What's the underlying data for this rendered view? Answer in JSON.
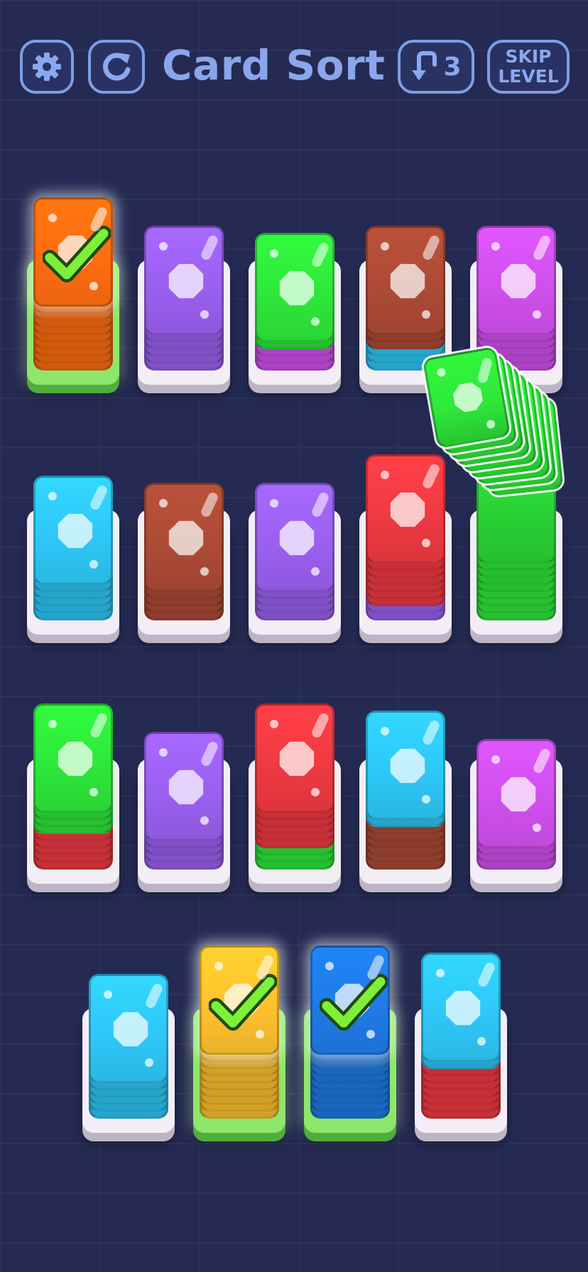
{
  "header": {
    "title": "Card Sort",
    "settings_icon": "gear-icon",
    "restart_icon": "restart-icon",
    "undo_icon": "undo-arrow-icon",
    "undo_count": "3",
    "skip_label_line1": "SKIP",
    "skip_label_line2": "LEVEL"
  },
  "colors": {
    "orange": "#ff6d10",
    "purple": "#9b60f0",
    "green": "#2ee83a",
    "brown": "#ad4b36",
    "magenta": "#d050ee",
    "cyan": "#2ec8f8",
    "red": "#f03a42",
    "yellow": "#ffc22e",
    "blue": "#1f7be6"
  },
  "stacks": [
    {
      "row": 1,
      "col": 1,
      "top": "orange",
      "completed": true,
      "layers": [
        "orange",
        "orange",
        "orange",
        "orange",
        "orange",
        "orange",
        "orange",
        "orange",
        "orange",
        "orange"
      ]
    },
    {
      "row": 1,
      "col": 2,
      "top": "purple",
      "completed": false,
      "layers": [
        "purple",
        "purple",
        "purple",
        "purple",
        "purple",
        "purple"
      ]
    },
    {
      "row": 1,
      "col": 3,
      "top": "green",
      "completed": false,
      "layers": [
        "magenta",
        "magenta",
        "magenta",
        "green",
        "green"
      ]
    },
    {
      "row": 1,
      "col": 4,
      "top": "brown",
      "completed": false,
      "layers": [
        "cyan",
        "cyan",
        "cyan",
        "brown",
        "brown",
        "brown"
      ]
    },
    {
      "row": 1,
      "col": 5,
      "top": "magenta",
      "completed": false,
      "layers": [
        "magenta",
        "magenta",
        "magenta",
        "magenta",
        "magenta",
        "magenta"
      ]
    },
    {
      "row": 2,
      "col": 1,
      "top": "cyan",
      "completed": false,
      "layers": [
        "cyan",
        "cyan",
        "cyan",
        "cyan",
        "cyan",
        "cyan"
      ]
    },
    {
      "row": 2,
      "col": 2,
      "top": "brown",
      "completed": false,
      "layers": [
        "brown",
        "brown",
        "brown",
        "brown",
        "brown"
      ]
    },
    {
      "row": 2,
      "col": 3,
      "top": "purple",
      "completed": false,
      "layers": [
        "purple",
        "purple",
        "purple",
        "purple",
        "purple"
      ]
    },
    {
      "row": 2,
      "col": 4,
      "top": "red",
      "completed": false,
      "layers": [
        "purple",
        "purple",
        "red",
        "red",
        "red",
        "red",
        "red",
        "red",
        "red"
      ]
    },
    {
      "row": 2,
      "col": 5,
      "top": "green",
      "completed": false,
      "selected": true,
      "layers": [
        "green",
        "green",
        "green",
        "green",
        "green",
        "green",
        "green",
        "green",
        "green",
        "green",
        "green",
        "green",
        "green"
      ]
    },
    {
      "row": 3,
      "col": 1,
      "top": "green",
      "completed": false,
      "layers": [
        "red",
        "red",
        "red",
        "red",
        "red",
        "green",
        "green",
        "green",
        "green"
      ]
    },
    {
      "row": 3,
      "col": 2,
      "top": "purple",
      "completed": false,
      "layers": [
        "purple",
        "purple",
        "purple",
        "purple",
        "purple"
      ]
    },
    {
      "row": 3,
      "col": 3,
      "top": "red",
      "completed": false,
      "layers": [
        "green",
        "green",
        "green",
        "red",
        "red",
        "red",
        "red",
        "red",
        "red"
      ]
    },
    {
      "row": 3,
      "col": 4,
      "top": "cyan",
      "completed": false,
      "layers": [
        "brown",
        "brown",
        "brown",
        "brown",
        "brown",
        "brown",
        "cyan",
        "cyan"
      ]
    },
    {
      "row": 3,
      "col": 5,
      "top": "magenta",
      "completed": false,
      "layers": [
        "magenta",
        "magenta",
        "magenta",
        "magenta"
      ]
    },
    {
      "row": 4,
      "col": 1,
      "top": "cyan",
      "completed": false,
      "layers": [
        "cyan",
        "cyan",
        "cyan",
        "cyan",
        "cyan",
        "cyan"
      ]
    },
    {
      "row": 4,
      "col": 2,
      "top": "yellow",
      "completed": true,
      "layers": [
        "yellow",
        "yellow",
        "yellow",
        "yellow",
        "yellow",
        "yellow",
        "yellow",
        "yellow",
        "yellow",
        "yellow"
      ]
    },
    {
      "row": 4,
      "col": 3,
      "top": "blue",
      "completed": true,
      "layers": [
        "blue",
        "blue",
        "blue",
        "blue",
        "blue",
        "blue",
        "blue",
        "blue",
        "blue",
        "blue"
      ]
    },
    {
      "row": 4,
      "col": 4,
      "top": "cyan",
      "completed": false,
      "layers": [
        "red",
        "red",
        "red",
        "red",
        "red",
        "red",
        "red",
        "cyan",
        "cyan"
      ]
    }
  ]
}
